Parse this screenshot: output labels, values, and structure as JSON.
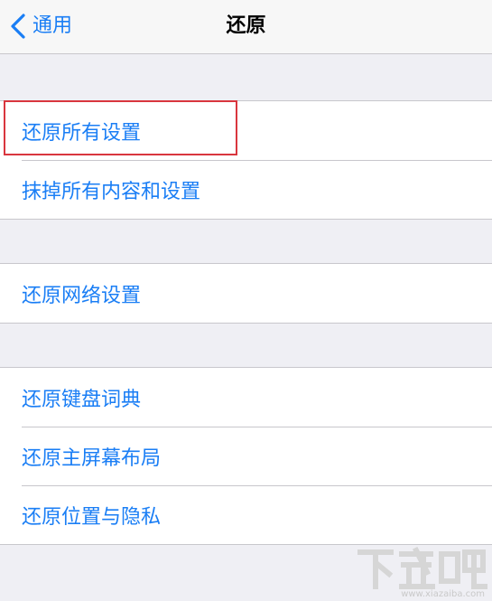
{
  "theme": {
    "accent": "#1a7ef5",
    "highlight": "#d9363e"
  },
  "navbar": {
    "back_icon": "chevron-left-icon",
    "back_label": "通用",
    "title": "还原"
  },
  "groups": [
    {
      "items": [
        {
          "label": "还原所有设置"
        },
        {
          "label": "抹掉所有内容和设置"
        }
      ]
    },
    {
      "items": [
        {
          "label": "还原网络设置"
        }
      ]
    },
    {
      "items": [
        {
          "label": "还原键盘词典"
        },
        {
          "label": "还原主屏幕布局"
        },
        {
          "label": "还原位置与隐私"
        }
      ]
    }
  ],
  "watermark": {
    "logo_text": "下载吧",
    "url": "www.xiazaiba.com"
  }
}
